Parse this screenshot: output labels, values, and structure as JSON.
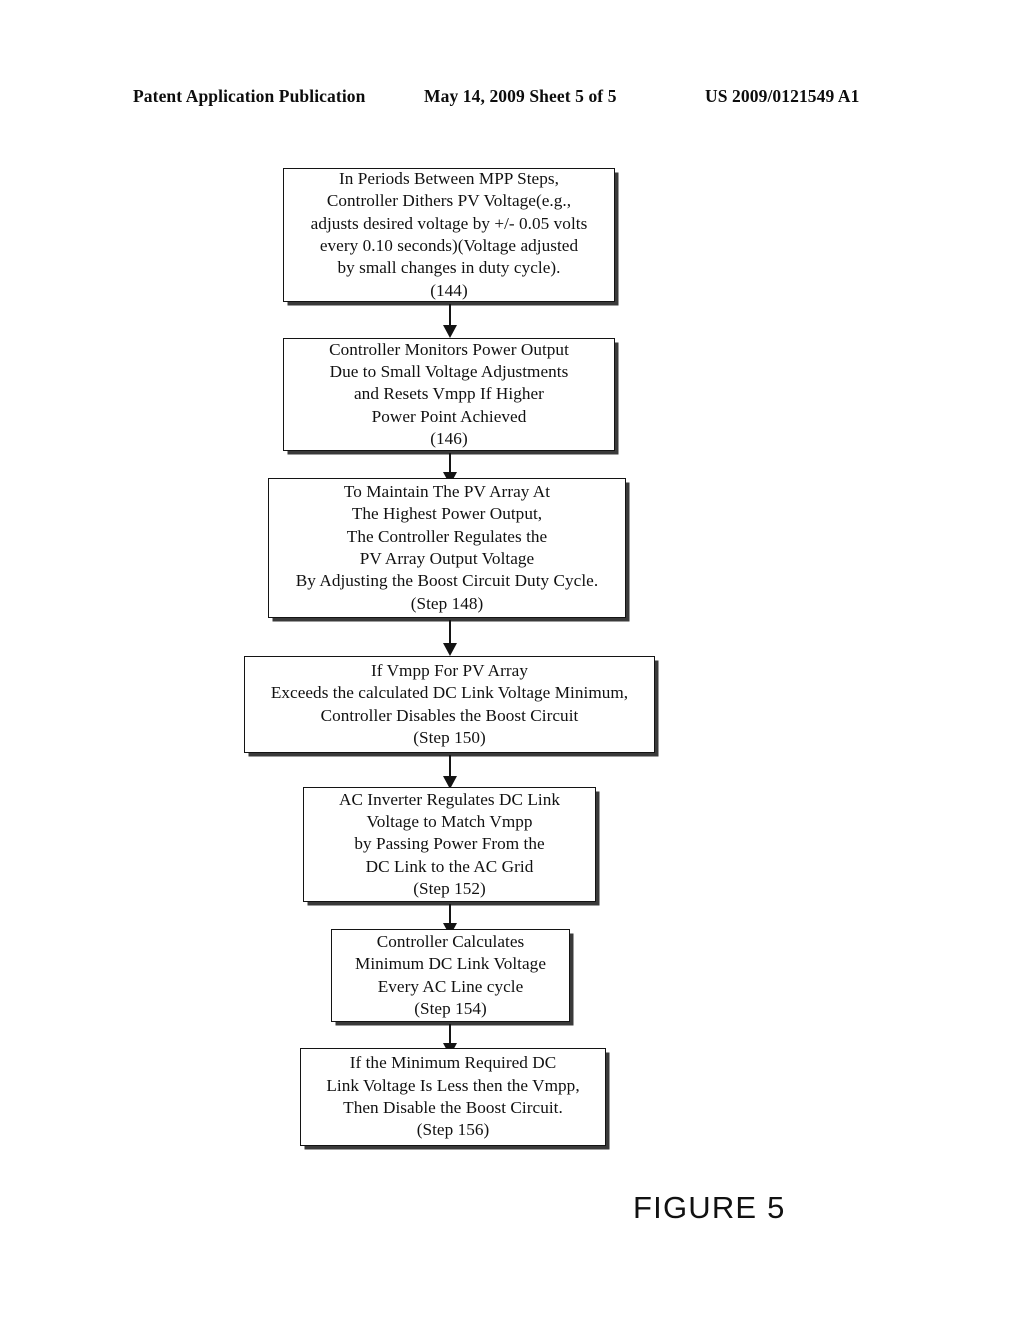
{
  "header": {
    "publication": "Patent Application Publication",
    "date_sheet": "May 14, 2009  Sheet 5 of 5",
    "patent_number": "US 2009/0121549 A1"
  },
  "figure": {
    "caption": "FIGURE 5"
  },
  "colors": {
    "page_background": "#ffffff",
    "ink": "#111111",
    "box_border": "#141414",
    "box_shadow": "#3a3a3a"
  },
  "chart_data": {
    "type": "diagram",
    "title": "FIGURE 5",
    "subtype": "flowchart",
    "orientation": "top-to-bottom",
    "nodes": [
      {
        "id": "144",
        "ref": "(144)",
        "text": "In Periods Between MPP Steps,\nController Dithers PV Voltage(e.g.,\nadjusts desired voltage by +/- 0.05 volts\nevery 0.10 seconds)(Voltage adjusted\nby small changes in duty cycle).\n(144)"
      },
      {
        "id": "146",
        "ref": "(146)",
        "text": "Controller Monitors Power Output\nDue to Small Voltage Adjustments\nand Resets Vmpp If Higher\nPower Point Achieved\n(146)"
      },
      {
        "id": "148",
        "ref": "(Step 148)",
        "text": "To Maintain The PV Array At\nThe Highest Power Output,\nThe Controller Regulates the\nPV Array Output Voltage\nBy Adjusting the Boost Circuit Duty Cycle.\n(Step 148)"
      },
      {
        "id": "150",
        "ref": "(Step 150)",
        "text": "If Vmpp For PV Array\nExceeds the calculated DC Link Voltage Minimum,\nController Disables the Boost Circuit\n(Step 150)"
      },
      {
        "id": "152",
        "ref": "(Step 152)",
        "text": "AC Inverter Regulates  DC Link\nVoltage to Match Vmpp\nby Passing Power From the\nDC Link to the AC Grid\n(Step 152)"
      },
      {
        "id": "154",
        "ref": "(Step 154)",
        "text": "Controller Calculates\nMinimum DC Link Voltage\nEvery AC Line cycle\n(Step 154)"
      },
      {
        "id": "156",
        "ref": "(Step 156)",
        "text": "If the Minimum Required DC\nLink Voltage Is Less then the Vmpp,\nThen Disable the Boost Circuit.\n(Step 156)"
      }
    ],
    "edges": [
      {
        "from": "144",
        "to": "146",
        "style": "arrow-down"
      },
      {
        "from": "146",
        "to": "148",
        "style": "arrow-down"
      },
      {
        "from": "148",
        "to": "150",
        "style": "arrow-down"
      },
      {
        "from": "150",
        "to": "152",
        "style": "arrow-down"
      },
      {
        "from": "152",
        "to": "154",
        "style": "arrow-down"
      },
      {
        "from": "154",
        "to": "156",
        "style": "arrow-down"
      }
    ]
  }
}
